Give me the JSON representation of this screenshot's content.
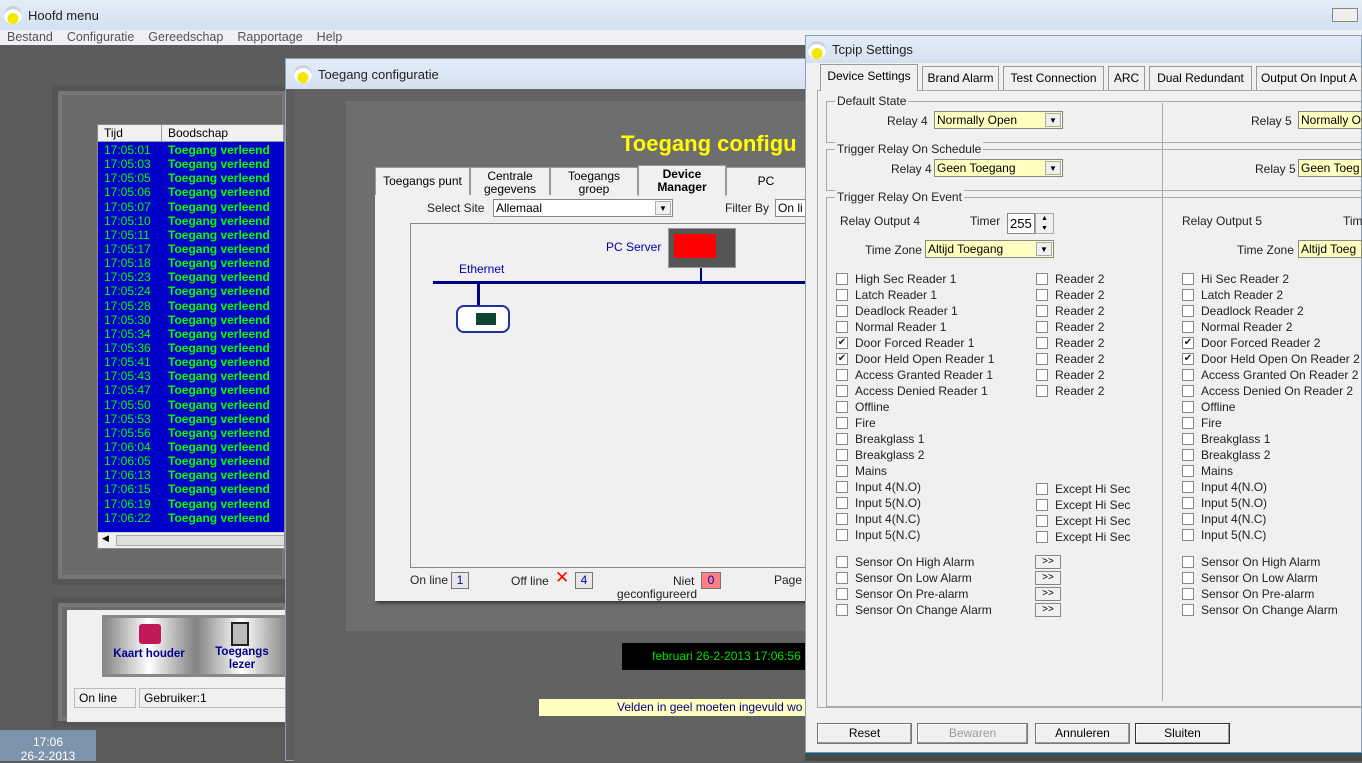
{
  "main": {
    "title": "Hoofd menu",
    "menu": [
      "Bestand",
      "Configuratie",
      "Gereedschap",
      "Rapportage",
      "Help"
    ],
    "log": {
      "columns": [
        "Tijd",
        "Boodschap"
      ],
      "message": "Toegang verleend",
      "times": [
        "17:05:01",
        "17:05:03",
        "17:05:05",
        "17:05:06",
        "17:05:07",
        "17:05:10",
        "17:05:11",
        "17:05:17",
        "17:05:18",
        "17:05:23",
        "17:05:24",
        "17:05:28",
        "17:05:30",
        "17:05:34",
        "17:05:36",
        "17:05:41",
        "17:05:43",
        "17:05:47",
        "17:05:50",
        "17:05:53",
        "17:05:56",
        "17:06:04",
        "17:06:05",
        "17:06:13",
        "17:06:15",
        "17:06:19",
        "17:06:22"
      ]
    },
    "buttons": {
      "card_holder": "Kaart houder",
      "reader_line1": "Toegangs",
      "reader_line2": "lezer"
    },
    "status": {
      "connection": "On line",
      "user": "Gebruiker:1"
    },
    "clock": {
      "time": "17:06",
      "date": "26-2-2013"
    }
  },
  "config": {
    "title": "Toegang configuratie",
    "heading": "Toegang configu",
    "tabs": [
      {
        "l1": "Toegangs punt",
        "l2": ""
      },
      {
        "l1": "Centrale",
        "l2": "gegevens"
      },
      {
        "l1": "Toegangs",
        "l2": "groep"
      },
      {
        "l1": "Device",
        "l2": "Manager"
      },
      {
        "l1": "PC",
        "l2": ""
      }
    ],
    "select_site_label": "Select Site",
    "select_site_value": "Allemaal",
    "filter_label": "Filter By",
    "filter_value": "On li",
    "diagram": {
      "server_label": "PC Server",
      "network_label": "Ethernet"
    },
    "counts": {
      "online_label": "On line",
      "online": "1",
      "offline_label": "Off line",
      "offline": "4",
      "unconfigured_label1": "Niet",
      "unconfigured_label2": "geconfigureerd",
      "unconfigured": "0",
      "page_label": "Page"
    },
    "datetime": "februari  26-2-2013 17:06:56",
    "note": "Velden in geel moeten ingevuld wo"
  },
  "tcpip": {
    "title": "Tcpip Settings",
    "tabs": [
      "Device Settings",
      "Brand Alarm",
      "Test Connection",
      "ARC",
      "Dual Redundant",
      "Output On Input A"
    ],
    "default_state": {
      "legend": "Default State",
      "relay4_label": "Relay 4",
      "relay4": "Normally Open",
      "relay5_label": "Relay 5",
      "relay5": "Normally O"
    },
    "schedule": {
      "legend": "Trigger Relay On Schedule",
      "relay4_label": "Relay 4",
      "relay4": "Geen Toegang",
      "relay5_label": "Relay 5",
      "relay5": "Geen Toeg"
    },
    "event": {
      "legend": "Trigger Relay On Event",
      "out4": "Relay Output 4",
      "timer_label": "Timer",
      "timer": "255",
      "out5": "Relay Output 5",
      "timer5_label": "Tim",
      "tz_label": "Time Zone",
      "tz4": "Altijd Toegang",
      "tz5": "Altijd Toeg",
      "left": [
        {
          "l": "High Sec Reader 1",
          "c": false
        },
        {
          "l": "Latch Reader 1",
          "c": false
        },
        {
          "l": "Deadlock Reader 1",
          "c": false
        },
        {
          "l": "Normal Reader 1",
          "c": false
        },
        {
          "l": "Door Forced Reader 1",
          "c": true
        },
        {
          "l": "Door Held Open Reader 1",
          "c": true
        },
        {
          "l": "Access Granted Reader 1",
          "c": false
        },
        {
          "l": "Access Denied Reader 1",
          "c": false
        },
        {
          "l": "Offline",
          "c": false
        },
        {
          "l": "Fire",
          "c": false
        },
        {
          "l": "Breakglass 1",
          "c": false
        },
        {
          "l": "Breakglass 2",
          "c": false
        },
        {
          "l": "Mains",
          "c": false
        },
        {
          "l": "Input 4(N.O)",
          "c": false
        },
        {
          "l": "Input 5(N.O)",
          "c": false
        },
        {
          "l": "Input 4(N.C)",
          "c": false
        },
        {
          "l": "Input 5(N.C)",
          "c": false
        }
      ],
      "left_reader2": "Reader 2",
      "except": "Except Hi Sec",
      "sensors_left": [
        "Sensor On High Alarm",
        "Sensor On Low Alarm",
        "Sensor On Pre-alarm",
        "Sensor On Change Alarm"
      ],
      "more": ">>",
      "right": [
        {
          "l": "Hi Sec Reader 2",
          "c": false
        },
        {
          "l": "Latch Reader 2",
          "c": false
        },
        {
          "l": "Deadlock  Reader 2",
          "c": false
        },
        {
          "l": "Normal Reader 2",
          "c": false
        },
        {
          "l": "Door Forced Reader 2",
          "c": true
        },
        {
          "l": "Door Held Open On Reader 2",
          "c": true
        },
        {
          "l": "Access Granted On Reader 2",
          "c": false
        },
        {
          "l": "Access Denied On Reader 2",
          "c": false
        },
        {
          "l": "Offline",
          "c": false
        },
        {
          "l": "Fire",
          "c": false
        },
        {
          "l": "Breakglass 1",
          "c": false
        },
        {
          "l": "Breakglass 2",
          "c": false
        },
        {
          "l": "Mains",
          "c": false
        },
        {
          "l": "Input 4(N.O)",
          "c": false
        },
        {
          "l": "Input 5(N.O)",
          "c": false
        },
        {
          "l": "Input 4(N.C)",
          "c": false
        },
        {
          "l": "Input 5(N.C)",
          "c": false
        }
      ],
      "sensors_right": [
        "Sensor On High Alarm",
        "Sensor On Low Alarm",
        "Sensor On Pre-alarm",
        "Sensor On Change Alarm"
      ]
    },
    "buttons": {
      "reset": "Reset",
      "save": "Bewaren",
      "cancel": "Annuleren",
      "close": "Sluiten"
    }
  },
  "colors": {
    "log_bg": "#0000c8",
    "log_text": "#00ff00",
    "heading": "#ffff00",
    "required_field": "#ffffc0"
  }
}
